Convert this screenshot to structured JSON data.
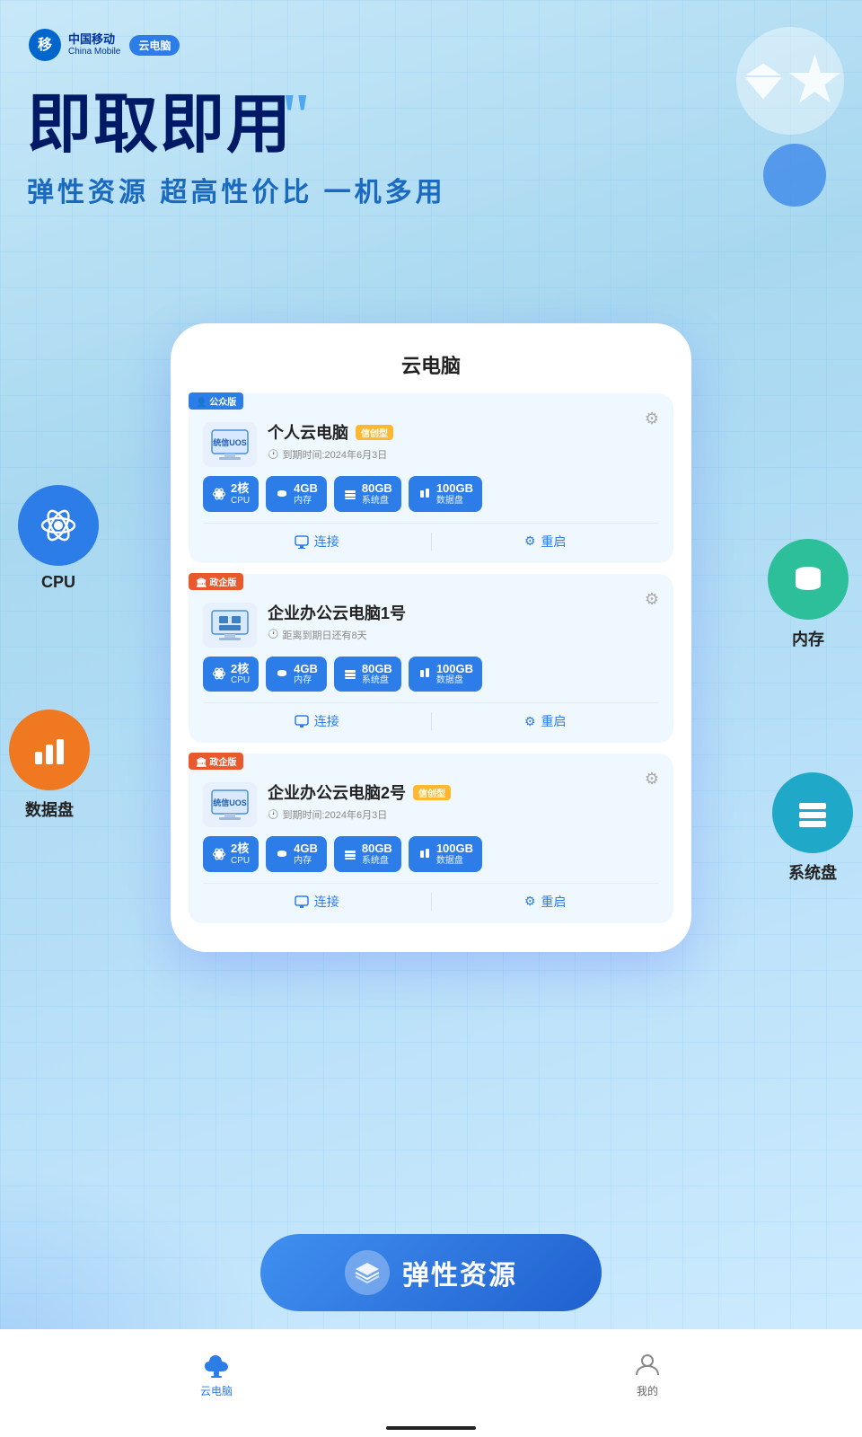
{
  "app": {
    "brand_cn": "中国移动",
    "brand_en": "China Mobile",
    "tag": "云电脑"
  },
  "hero": {
    "title": "即取即用",
    "quote": "”",
    "subtitle": "弹性资源 超高性价比 一机多用"
  },
  "phone": {
    "title": "云电脑"
  },
  "cards": [
    {
      "badge": "公众版",
      "badge_type": "public",
      "name": "个人云电脑",
      "tag": "信创型",
      "expire": "到期时间:2024年6月3日",
      "specs": [
        {
          "value": "2核",
          "label": "CPU"
        },
        {
          "value": "4GB",
          "label": "内存"
        },
        {
          "value": "80GB",
          "label": "系统盘"
        },
        {
          "value": "100GB",
          "label": "数据盘"
        }
      ],
      "actions": [
        "连接",
        "重启"
      ]
    },
    {
      "badge": "政企版",
      "badge_type": "gov",
      "name": "企业办公云电脑1号",
      "tag": null,
      "expire": "距离到期日还有8天",
      "specs": [
        {
          "value": "2核",
          "label": "CPU"
        },
        {
          "value": "4GB",
          "label": "内存"
        },
        {
          "value": "80GB",
          "label": "系统盘"
        },
        {
          "value": "100GB",
          "label": "数据盘"
        }
      ],
      "actions": [
        "连接",
        "重启"
      ]
    },
    {
      "badge": "政企版",
      "badge_type": "gov",
      "name": "企业办公云电脑2号",
      "tag": "信创型",
      "expire": "到期时间:2024年6月3日",
      "specs": [
        {
          "value": "2核",
          "label": "CPU"
        },
        {
          "value": "4GB",
          "label": "内存"
        },
        {
          "value": "80GB",
          "label": "系统盘"
        },
        {
          "value": "100GB",
          "label": "数据盘"
        }
      ],
      "actions": [
        "连接",
        "重启"
      ]
    }
  ],
  "floats": {
    "cpu_label": "CPU",
    "data_label": "数据盘",
    "memory_label": "内存",
    "storage_label": "系统盘"
  },
  "cta": {
    "label": "弹性资源"
  },
  "nav": {
    "items": [
      {
        "label": "云电脑",
        "active": true
      },
      {
        "label": "我的",
        "active": false
      }
    ]
  }
}
